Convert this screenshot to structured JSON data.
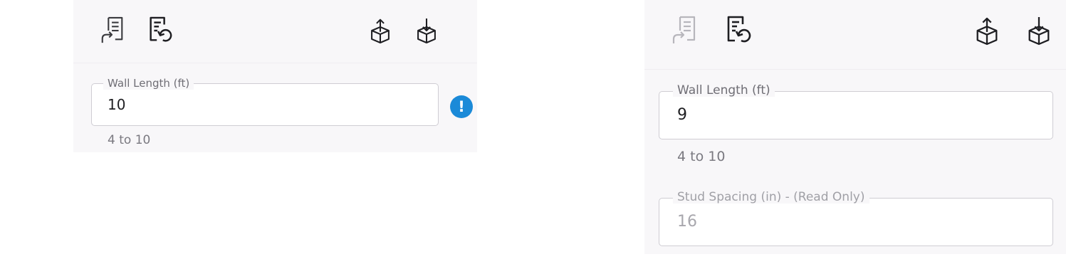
{
  "left_panel": {
    "toolbar": {
      "icons": [
        "apply-params-icon",
        "reset-params-icon",
        "export-cube-icon",
        "import-cube-icon"
      ]
    },
    "wall_length": {
      "label": "Wall Length (ft)",
      "value": "10",
      "range": "4 to 10"
    },
    "warning_icon": {
      "glyph": "!",
      "color": "#1b8ad8"
    }
  },
  "right_panel": {
    "toolbar": {
      "icons": [
        "apply-params-icon",
        "reset-params-icon",
        "export-cube-icon",
        "import-cube-icon"
      ]
    },
    "wall_length": {
      "label": "Wall Length (ft)",
      "value": "9",
      "range": "4 to 10"
    },
    "stud_spacing": {
      "label": "Stud Spacing (in) - (Read Only)",
      "value": "16"
    }
  }
}
